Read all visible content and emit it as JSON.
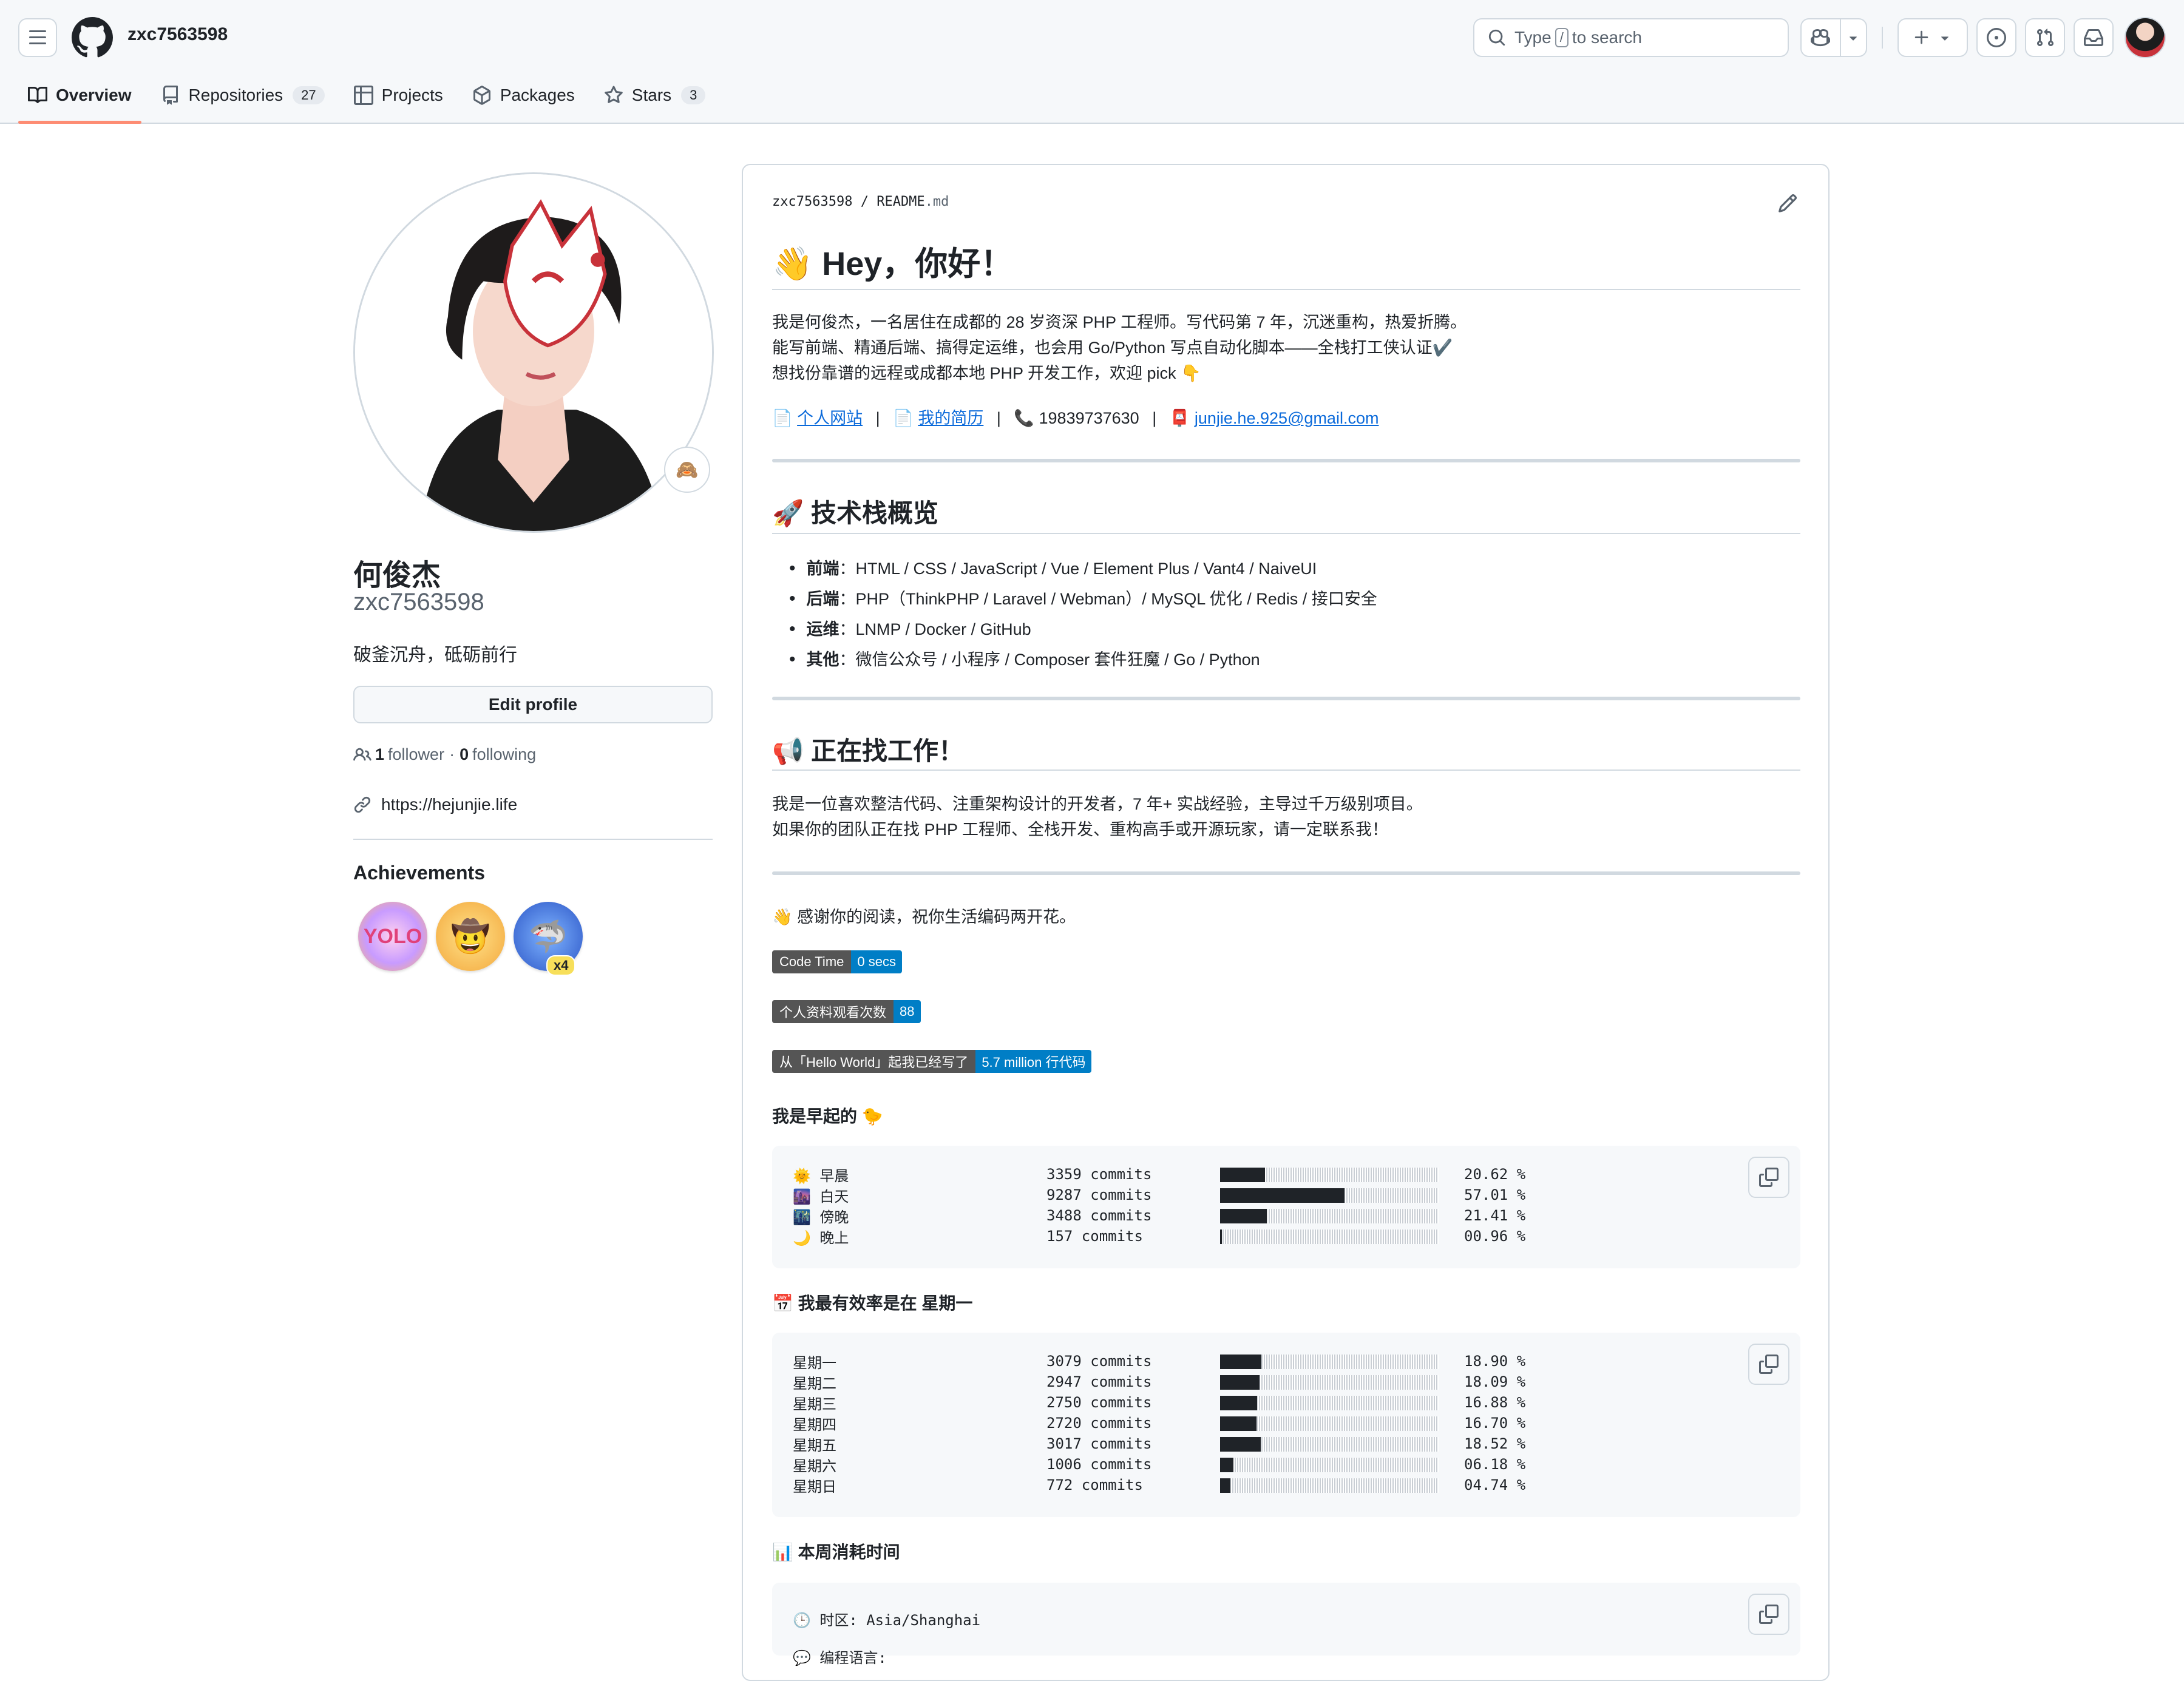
{
  "header": {
    "username": "zxc7563598",
    "search_pre": "Type",
    "search_key": "/",
    "search_post": "to search"
  },
  "tabs": [
    {
      "label": "Overview"
    },
    {
      "label": "Repositories",
      "count": "27"
    },
    {
      "label": "Projects"
    },
    {
      "label": "Packages"
    },
    {
      "label": "Stars",
      "count": "3"
    }
  ],
  "profile": {
    "status_emoji": "🙈",
    "name": "何俊杰",
    "login": "zxc7563598",
    "bio": "破釜沉舟，砥砺前行",
    "edit_label": "Edit profile",
    "followers": "1",
    "followers_label": "follower",
    "sep": "·",
    "following": "0",
    "following_label": "following",
    "website": "https://hejunjie.life",
    "achievements_title": "Achievements",
    "achievement_count": "x4"
  },
  "readme": {
    "crumb_user": "zxc7563598",
    "crumb_sep": "/",
    "crumb_file": "README",
    "crumb_ext": ".md",
    "title": "👋 Hey，你好！",
    "intro": [
      "我是何俊杰，一名居住在成都的 28 岁资深 PHP 工程师。写代码第 7 年，沉迷重构，热爱折腾。",
      "能写前端、精通后端、搞得定运维，也会用 Go/Python 写点自动化脚本——全栈打工侠认证✔️",
      "想找份靠谱的远程或成都本地 PHP 开发工作，欢迎 pick 👇"
    ],
    "links": {
      "site_icon": "📄",
      "site": "个人网站",
      "resume_icon": "📄",
      "resume": "我的简历",
      "phone_icon": "📞",
      "phone": "19839737630",
      "mail_icon": "📮",
      "email": "junjie.he.925@gmail.com",
      "sep": "|"
    },
    "stack_title": "🚀 技术栈概览",
    "stack": [
      {
        "k": "前端",
        "v": "：HTML / CSS / JavaScript / Vue / Element Plus / Vant4 / NaiveUI"
      },
      {
        "k": "后端",
        "v": "：PHP（ThinkPHP / Laravel / Webman）/ MySQL 优化 / Redis / 接口安全"
      },
      {
        "k": "运维",
        "v": "：LNMP / Docker / GitHub"
      },
      {
        "k": "其他",
        "v": "：微信公众号 / 小程序 / Composer 套件狂魔 / Go / Python"
      }
    ],
    "job_title": "📢 正在找工作！",
    "job": [
      "我是一位喜欢整洁代码、注重架构设计的开发者，7 年+ 实战经验，主导过千万级别项目。",
      "如果你的团队正在找 PHP 工程师、全栈开发、重构高手或开源玩家，请一定联系我！"
    ],
    "thanks": "👋 感谢你的阅读，祝你生活编码两开花。",
    "shields": [
      {
        "label": "Code Time",
        "value": "0 secs"
      },
      {
        "label": "个人资料观看次数",
        "value": "88"
      },
      {
        "label": "从「Hello World」起我已经写了",
        "value": "5.7 million 行代码"
      }
    ],
    "early_title": "我是早起的 🐤",
    "early_rows": [
      {
        "label": "🌞 早晨",
        "commits": "3359 commits",
        "pct": "20.62 %",
        "fill": 0.2062
      },
      {
        "label": "🌆 白天",
        "commits": "9287 commits",
        "pct": "57.01 %",
        "fill": 0.5701
      },
      {
        "label": "🌃 傍晚",
        "commits": "3488 commits",
        "pct": "21.41 %",
        "fill": 0.2141
      },
      {
        "label": "🌙 晚上",
        "commits": "157 commits",
        "pct": "00.96 %",
        "fill": 0.0096
      }
    ],
    "week_title": "📅 我最有效率是在 星期一",
    "week_rows": [
      {
        "label": "星期一",
        "commits": "3079 commits",
        "pct": "18.90 %",
        "fill": 0.189
      },
      {
        "label": "星期二",
        "commits": "2947 commits",
        "pct": "18.09 %",
        "fill": 0.1809
      },
      {
        "label": "星期三",
        "commits": "2750 commits",
        "pct": "16.88 %",
        "fill": 0.1688
      },
      {
        "label": "星期四",
        "commits": "2720 commits",
        "pct": "16.70 %",
        "fill": 0.167
      },
      {
        "label": "星期五",
        "commits": "3017 commits",
        "pct": "18.52 %",
        "fill": 0.1852
      },
      {
        "label": "星期六",
        "commits": "1006 commits",
        "pct": "06.18 %",
        "fill": 0.0618
      },
      {
        "label": "星期日",
        "commits": "772 commits",
        "pct": "04.74 %",
        "fill": 0.0474
      }
    ],
    "time_title": "📊 本周消耗时间",
    "tz": "🕒 时区: Asia/Shanghai",
    "lang_partial": "💬 编程语言:"
  }
}
